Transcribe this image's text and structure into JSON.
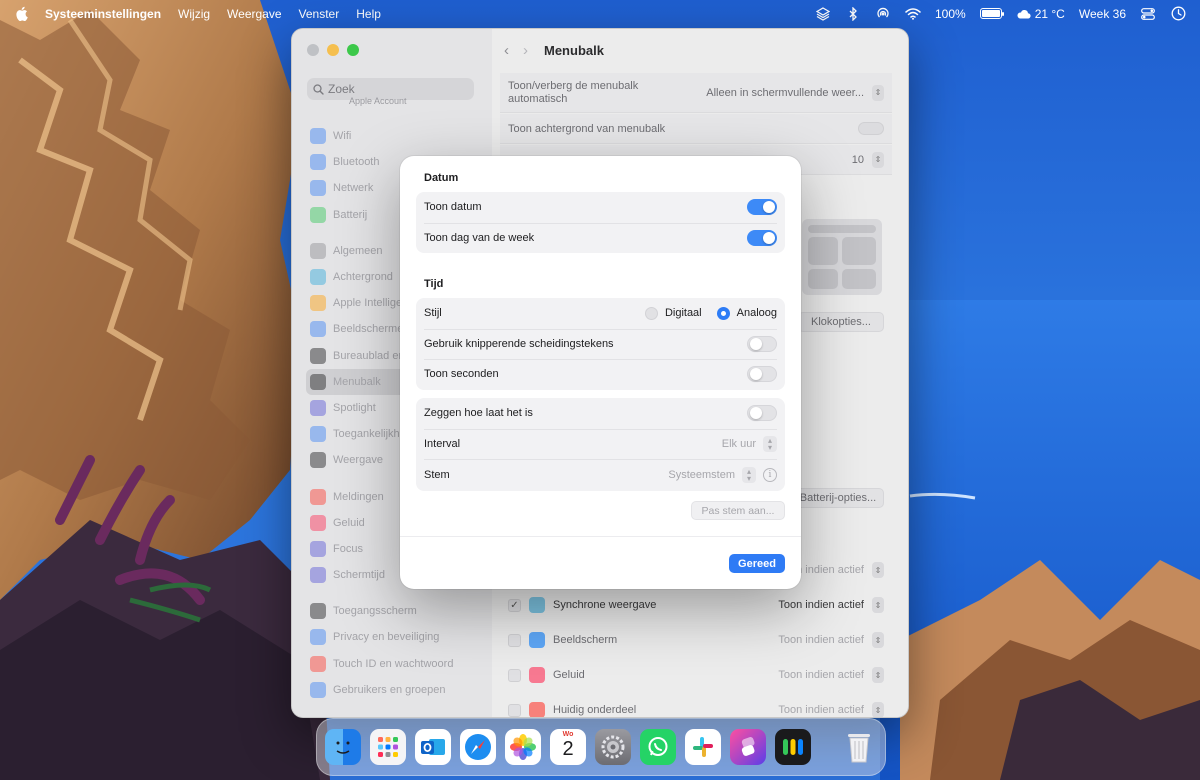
{
  "menubar": {
    "app_name": "Systeeminstellingen",
    "menus": [
      "Wijzig",
      "Weergave",
      "Venster",
      "Help"
    ],
    "battery": "100%",
    "weather": "21 °C",
    "week": "Week 36",
    "icons": [
      "apple-icon",
      "layers-icon",
      "bluetooth-icon",
      "airdrop-icon",
      "wifi-icon",
      "battery-icon",
      "cloud-icon",
      "control-center-icon",
      "clock-icon"
    ]
  },
  "window": {
    "title": "Menubalk",
    "search_placeholder": "Zoek",
    "apple_account": "Apple Account",
    "sidebar": [
      {
        "label": "Wifi",
        "color": "#3b82f6"
      },
      {
        "label": "Bluetooth",
        "color": "#3b82f6"
      },
      {
        "label": "Netwerk",
        "color": "#3b82f6"
      },
      {
        "label": "Batterij",
        "color": "#34c759"
      },
      {
        "label": "Algemeen",
        "color": "#8e8e93"
      },
      {
        "label": "Achtergrond",
        "color": "#34aadc"
      },
      {
        "label": "Apple Intellige",
        "color": "#ff9f0a"
      },
      {
        "label": "Beeldscherme",
        "color": "#3b82f6"
      },
      {
        "label": "Bureaublad en",
        "color": "#1c1c1e"
      },
      {
        "label": "Menubalk",
        "color": "#1c1c1e"
      },
      {
        "label": "Spotlight",
        "color": "#5856d6"
      },
      {
        "label": "Toegankelijkh",
        "color": "#3b82f6"
      },
      {
        "label": "Weergave",
        "color": "#1c1c1e"
      },
      {
        "label": "Meldingen",
        "color": "#ff3b30"
      },
      {
        "label": "Geluid",
        "color": "#ff2d55"
      },
      {
        "label": "Focus",
        "color": "#5856d6"
      },
      {
        "label": "Schermtijd",
        "color": "#5856d6"
      },
      {
        "label": "Toegangsscherm",
        "color": "#1c1c1e"
      },
      {
        "label": "Privacy en beveiliging",
        "color": "#3b82f6"
      },
      {
        "label": "Touch ID en wachtwoord",
        "color": "#ff3b30"
      },
      {
        "label": "Gebruikers en groepen",
        "color": "#3b82f6"
      }
    ],
    "selected_sidebar": "Menubalk",
    "rows": {
      "autohide_label": "Toon/verberg de menubalk automatisch",
      "autohide_value": "Alleen in schermvullende weer...",
      "background_label": "Toon achtergrond van menubalk",
      "number_value": "10"
    },
    "clock_options_button": "Klokopties...",
    "battery_options_button": "Batterij-opties...",
    "list": [
      {
        "label": "",
        "value": "Toon indien actief",
        "checked": false
      },
      {
        "label": "Synchrone weergave",
        "value": "Toon indien actief",
        "checked": true
      },
      {
        "label": "Beeldscherm",
        "value": "Toon indien actief",
        "checked": false
      },
      {
        "label": "Geluid",
        "value": "Toon indien actief",
        "checked": false
      },
      {
        "label": "Huidig onderdeel",
        "value": "Toon indien actief",
        "checked": false
      }
    ]
  },
  "sheet": {
    "datum_title": "Datum",
    "show_date": "Toon datum",
    "show_weekday": "Toon dag van de week",
    "tijd_title": "Tijd",
    "style_label": "Stijl",
    "style_digital": "Digitaal",
    "style_analog": "Analoog",
    "blink_label": "Gebruik knipperende scheidingstekens",
    "seconds_label": "Toon seconden",
    "announce_label": "Zeggen hoe laat het is",
    "interval_label": "Interval",
    "interval_value": "Elk uur",
    "voice_label": "Stem",
    "voice_value": "Systeemstem",
    "customize_voice_button": "Pas stem aan...",
    "done_button": "Gereed",
    "accent": "#2f7bf5"
  },
  "dock": {
    "apps": [
      "Finder",
      "Launchpad",
      "Outlook",
      "Safari",
      "Foto's",
      "Agenda",
      "Systeeminstellingen",
      "WhatsApp",
      "Slack",
      "Opdrachten",
      "Wachtwoorden",
      "Prullenmand"
    ],
    "calendar_month": "Wo",
    "calendar_day": "2"
  }
}
